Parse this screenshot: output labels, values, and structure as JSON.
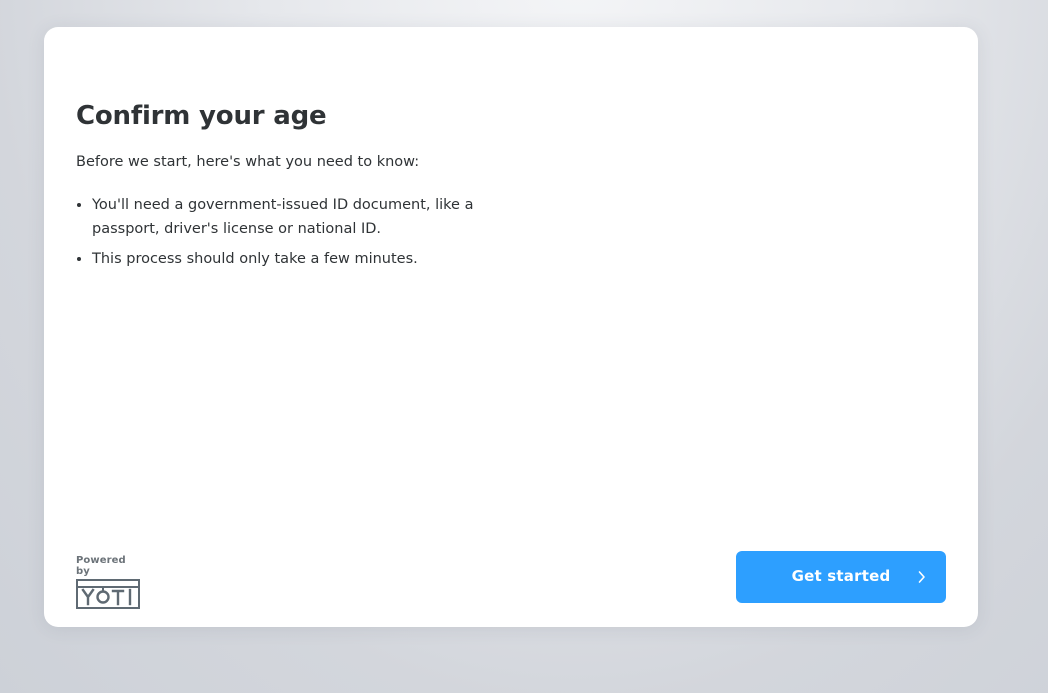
{
  "page": {
    "title": "Confirm your age",
    "intro": "Before we start, here's what you need to know:",
    "requirements": [
      "You'll need a government-issued ID document, like a passport, driver's license or national ID.",
      "This process should only take a few minutes."
    ]
  },
  "footer": {
    "powered_by_label": "Powered by",
    "logo_text": "YOTI",
    "logo_icon": "yoti-logo"
  },
  "actions": {
    "primary_label": "Get started",
    "primary_icon": "chevron-right-icon"
  },
  "colors": {
    "accent": "#2d9fff",
    "text": "#2f3336",
    "logo": "#5f6a73"
  }
}
